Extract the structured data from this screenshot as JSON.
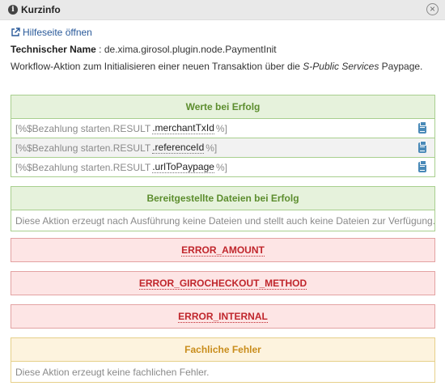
{
  "window": {
    "title": "Kurzinfo",
    "close_label": "×"
  },
  "help_link": "Hilfeseite öffnen",
  "technical": {
    "label": "Technischer Name",
    "separator": " : ",
    "value": "de.xima.girosol.plugin.node.PaymentInit"
  },
  "description": {
    "prefix": "Workflow-Aktion zum Initialisieren einer neuen Transaktion über die ",
    "emphasis": "S-Public Services",
    "suffix": " Paypage."
  },
  "success": {
    "title": "Werte bei Erfolg",
    "rows": [
      {
        "prefix": "[%$Bezahlung starten.RESULT ",
        "dot": ".",
        "name": "merchantTxId",
        "suffix": " %]"
      },
      {
        "prefix": "[%$Bezahlung starten.RESULT ",
        "dot": ".",
        "name": "referenceId",
        "suffix": " %]"
      },
      {
        "prefix": "[%$Bezahlung starten.RESULT ",
        "dot": ".",
        "name": "urlToPaypage",
        "suffix": " %]"
      }
    ]
  },
  "files": {
    "title": "Bereitgestellte Dateien bei Erfolg",
    "text": "Diese Aktion erzeugt nach Ausführung keine Dateien und stellt auch keine Dateien zur Verfügung."
  },
  "errors": [
    "ERROR_AMOUNT",
    "ERROR_GIROCHECKOUT_METHOD",
    "ERROR_INTERNAL"
  ],
  "business_errors": {
    "title": "Fachliche Fehler",
    "text": "Diese Aktion erzeugt keine fachlichen Fehler."
  },
  "colors": {
    "success": "#5c8d2e",
    "error": "#c0262c",
    "warning": "#c98d1c",
    "link": "#2a5a9a"
  },
  "icons": {
    "title": "info-icon",
    "close": "close-icon",
    "help": "external-link-icon",
    "copy": "clipboard-icon"
  }
}
